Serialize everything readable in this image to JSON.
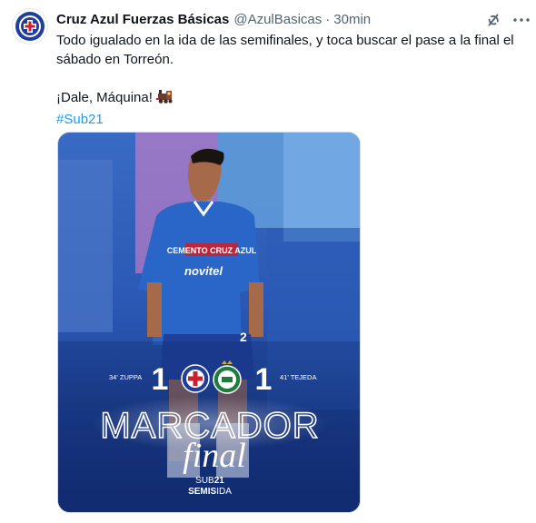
{
  "tweet": {
    "author_name": "Cruz Azul Fuerzas Básicas",
    "handle": "@AzulBasicas",
    "separator": "·",
    "time": "30min",
    "line1": "Todo igualado en la ida de las semifinales, y toca buscar el pase a la final el sábado en Torreón.",
    "line2": "¡Dale, Máquina!",
    "hashtag": "#Sub21"
  },
  "graphic": {
    "home_scorer": "34' ZUPPA",
    "away_scorer": "41' TEJEDA",
    "home_score": "1",
    "away_score": "1",
    "title": "MARCADOR",
    "title_script": "final",
    "category_prefix": "SUB",
    "category_number": "21",
    "stage": "SEMIS",
    "stage_suffix": "IDA",
    "jersey_sponsor": "CEMENTO CRUZ AZUL",
    "jersey_sponsor2": "novitel",
    "jersey_number": "2"
  },
  "colors": {
    "hashtag": "#1d9bf0",
    "muted": "#536471",
    "brand_blue": "#1f3f9a",
    "jersey_blue": "#2a66c8"
  }
}
